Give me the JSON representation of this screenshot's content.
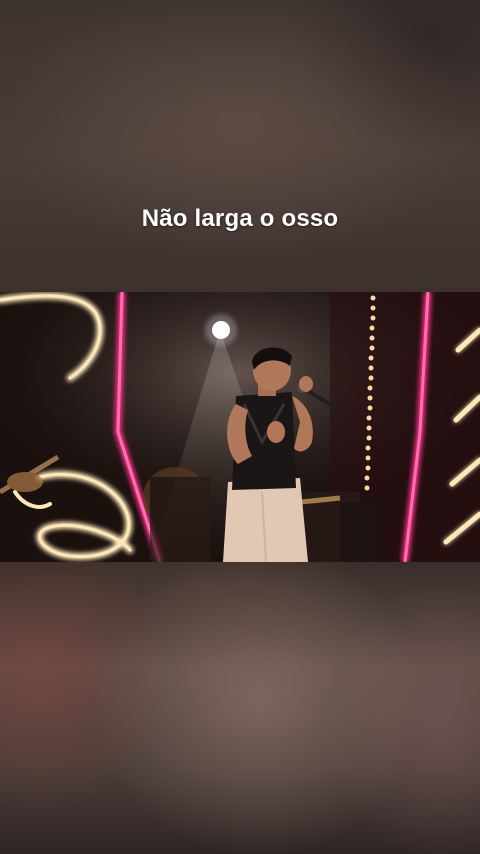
{
  "video": {
    "caption": "Não larga o osso"
  },
  "colors": {
    "neon_pink": "#ff2e8a",
    "warm_light": "#ffe7b8",
    "background": "#2a2220"
  }
}
